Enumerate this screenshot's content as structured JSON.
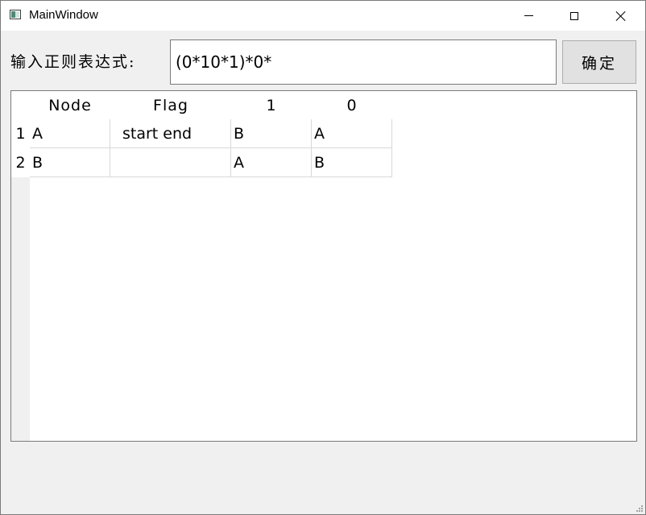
{
  "window": {
    "title": "MainWindow",
    "minimize_icon": "minimize-icon",
    "maximize_icon": "maximize-icon",
    "close_icon": "close-icon"
  },
  "form": {
    "label": "输入正则表达式:",
    "input_value": "(0*10*1)*0*",
    "confirm_label": "确定"
  },
  "table": {
    "columns": [
      "Node",
      "Flag",
      "1",
      "0"
    ],
    "rows": [
      {
        "header": "1",
        "cells": [
          "A",
          "start end",
          "B",
          "A"
        ]
      },
      {
        "header": "2",
        "cells": [
          "B",
          "",
          "A",
          "B"
        ]
      }
    ]
  },
  "colors": {
    "background": "#f0f0f0",
    "titlebar": "#ffffff",
    "button": "#e1e1e1",
    "grid_line": "#d8d8d8"
  }
}
